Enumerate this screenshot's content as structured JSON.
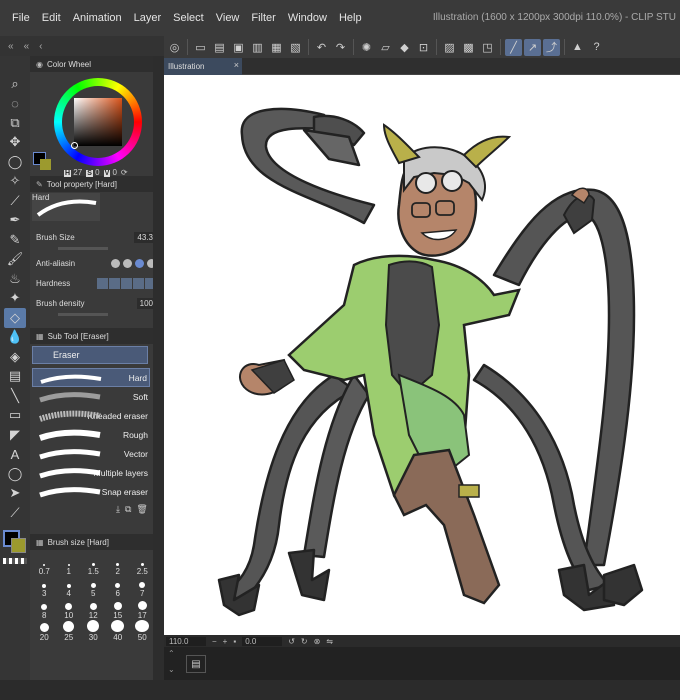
{
  "menu": {
    "items": [
      "File",
      "Edit",
      "Animation",
      "Layer",
      "Select",
      "View",
      "Filter",
      "Window",
      "Help"
    ],
    "window_title": "Illustration (1600 x 1200px 300dpi 110.0%) - CLIP STU"
  },
  "tab": {
    "label": "Illustration",
    "close": "×"
  },
  "color_wheel": {
    "title": "Color Wheel",
    "h_label": "H",
    "h_value": "27",
    "s_label": "S",
    "s_value": "0",
    "v_label": "V",
    "v_value": "0"
  },
  "tool_property": {
    "title": "Tool property [Hard]",
    "preset": "Hard",
    "brush_size_label": "Brush Size",
    "brush_size_value": "43.3",
    "anti_alias_label": "Anti-aliasin",
    "hardness_label": "Hardness",
    "brush_density_label": "Brush density",
    "brush_density_value": "100"
  },
  "sub_tool": {
    "title": "Sub Tool [Eraser]",
    "group": "Eraser",
    "brushes": [
      "Hard",
      "Soft",
      "Kneaded eraser",
      "Rough",
      "Vector",
      "Multiple layers",
      "Snap eraser"
    ],
    "active_index": 0
  },
  "brush_size": {
    "title": "Brush size [Hard]",
    "sizes": [
      "0.7",
      "1",
      "1.5",
      "2",
      "2.5",
      "3",
      "4",
      "5",
      "6",
      "7",
      "8",
      "10",
      "12",
      "15",
      "17",
      "20",
      "25",
      "30",
      "40",
      "50"
    ]
  },
  "status": {
    "zoom": "110.0",
    "angle": "0.0"
  },
  "colors": {
    "main": "#000000",
    "sub": "#9c9a2e",
    "accent": "#5a7aa8"
  }
}
